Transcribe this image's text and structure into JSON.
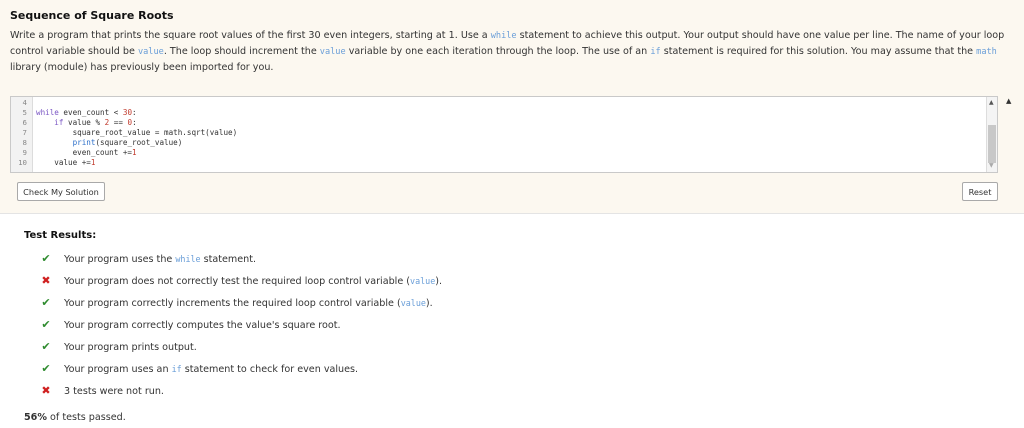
{
  "problem": {
    "title": "Sequence of Square Roots",
    "p1": "Write a program that prints the square root values of the first 30 even integers, starting at 1. Use a ",
    "kw_while": "while",
    "p2": " statement to achieve this output. Your output should have one value per line. The name of your loop control variable should be ",
    "kw_value": "value",
    "p3": ". The loop should increment the ",
    "kw_value2": "value",
    "p4": " variable by one each iteration through the loop. The use of an ",
    "kw_if": "if",
    "p5": " statement is required for this solution. You may assume that the ",
    "kw_math": "math",
    "p6": " library (module) has previously been imported for you."
  },
  "editor": {
    "lines": [
      {
        "num": "4",
        "text": ""
      },
      {
        "num": "5",
        "text": "while even_count < 30:"
      },
      {
        "num": "6",
        "text": "    if value % 2 == 0:"
      },
      {
        "num": "7",
        "text": "        square_root_value = math.sqrt(value)"
      },
      {
        "num": "8",
        "text": "        print(square_root_value)"
      },
      {
        "num": "9",
        "text": "        even_count +=1"
      },
      {
        "num": "10",
        "text": "    value +=1"
      }
    ]
  },
  "buttons": {
    "check": "Check My Solution",
    "reset": "Reset"
  },
  "results": {
    "title": "Test Results:",
    "items": [
      {
        "status": "pass",
        "mark": "✔",
        "pre": "Your program uses the ",
        "kw": "while",
        "post": " statement."
      },
      {
        "status": "fail",
        "mark": "✖",
        "pre": "Your program does not correctly test the required loop control variable (",
        "kw": "value",
        "post": ")."
      },
      {
        "status": "pass",
        "mark": "✔",
        "pre": "Your program correctly increments the required loop control variable (",
        "kw": "value",
        "post": ")."
      },
      {
        "status": "pass",
        "mark": "✔",
        "pre": "Your program correctly computes the value's square root.",
        "kw": "",
        "post": ""
      },
      {
        "status": "pass",
        "mark": "✔",
        "pre": "Your program prints output.",
        "kw": "",
        "post": ""
      },
      {
        "status": "pass",
        "mark": "✔",
        "pre": "Your program uses an ",
        "kw": "if",
        "post": " statement to check for even values."
      },
      {
        "status": "fail",
        "mark": "✖",
        "pre": "3 tests were not run.",
        "kw": "",
        "post": ""
      }
    ],
    "percent": "56%",
    "summary_rest": " of tests passed."
  },
  "colors": {
    "pass": "#2e8b2e",
    "fail": "#d02020",
    "keyword": "#6a9ed8"
  }
}
